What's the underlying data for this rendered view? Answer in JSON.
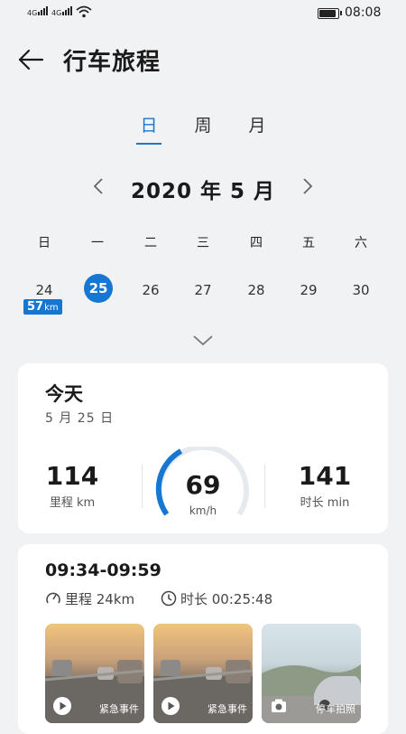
{
  "status_bar": {
    "signal1": "4G",
    "signal2": "4G",
    "time": "08:08"
  },
  "header": {
    "title": "行车旅程"
  },
  "tabs": [
    {
      "label": "日",
      "active": true
    },
    {
      "label": "周",
      "active": false
    },
    {
      "label": "月",
      "active": false
    }
  ],
  "calendar": {
    "month_label": "2020 年 5 月",
    "weekdays": [
      "日",
      "一",
      "二",
      "三",
      "四",
      "五",
      "六"
    ],
    "days": [
      "24",
      "25",
      "26",
      "27",
      "28",
      "29",
      "30"
    ],
    "selected_day": "25",
    "badge_value": "57",
    "badge_unit": "km"
  },
  "summary": {
    "title": "今天",
    "date": "5 月 25 日",
    "distance_value": "114",
    "distance_label": "里程 km",
    "speed_value": "69",
    "speed_unit": "km/h",
    "duration_value": "141",
    "duration_label": "时长 min"
  },
  "trip": {
    "time_range": "09:34-09:59",
    "distance": "里程 24km",
    "duration": "时长 00:25:48",
    "media": [
      {
        "label": "紧急事件",
        "kind": "play-icon"
      },
      {
        "label": "紧急事件",
        "kind": "play-icon"
      },
      {
        "label": "停车拍照",
        "kind": "camera-icon"
      }
    ]
  },
  "colors": {
    "accent": "#1677d2",
    "background": "#f1f2f4"
  }
}
